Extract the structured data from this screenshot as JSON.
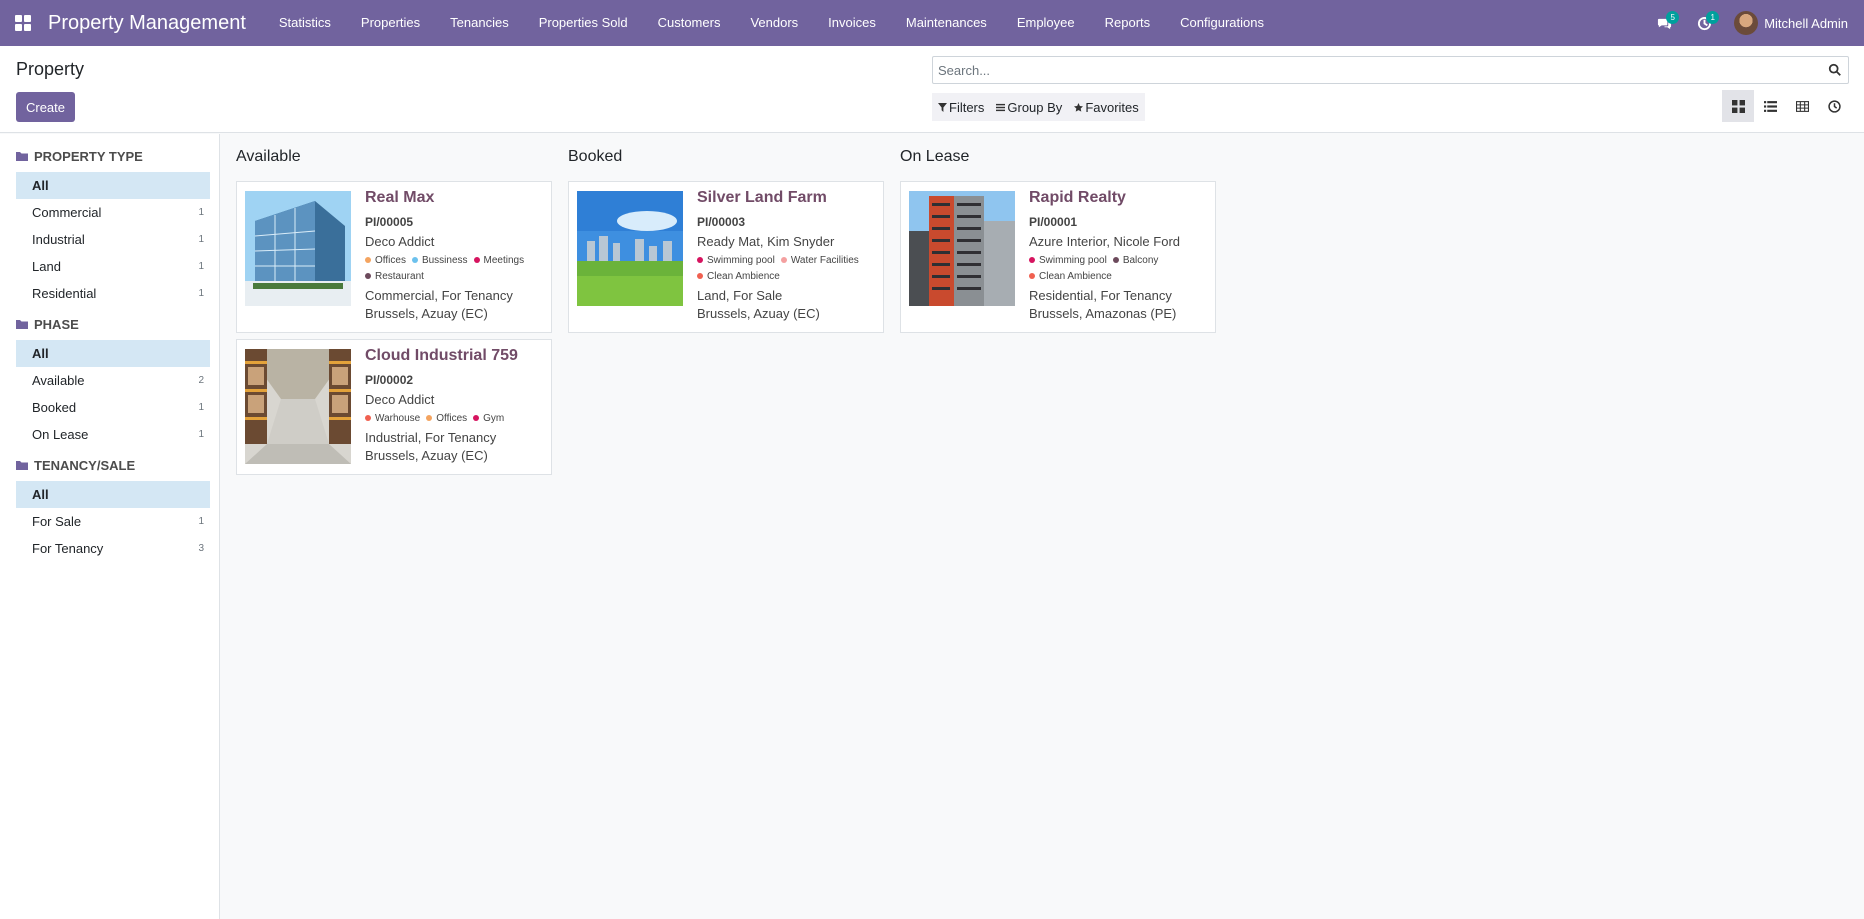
{
  "app": {
    "title": "Property Management"
  },
  "nav": {
    "items": [
      "Statistics",
      "Properties",
      "Tenancies",
      "Properties Sold",
      "Customers",
      "Vendors",
      "Invoices",
      "Maintenances",
      "Employee",
      "Reports",
      "Configurations"
    ],
    "messages_count": "5",
    "activities_count": "1",
    "user_name": "Mitchell Admin"
  },
  "control": {
    "breadcrumb": "Property",
    "create_label": "Create",
    "search_placeholder": "Search...",
    "filters_label": "Filters",
    "groupby_label": "Group By",
    "favorites_label": "Favorites"
  },
  "sidebar": {
    "sections": [
      {
        "title": "PROPERTY TYPE",
        "items": [
          {
            "label": "All",
            "count": "",
            "active": true
          },
          {
            "label": "Commercial",
            "count": "1"
          },
          {
            "label": "Industrial",
            "count": "1"
          },
          {
            "label": "Land",
            "count": "1"
          },
          {
            "label": "Residential",
            "count": "1"
          }
        ]
      },
      {
        "title": "PHASE",
        "items": [
          {
            "label": "All",
            "count": "",
            "active": true
          },
          {
            "label": "Available",
            "count": "2"
          },
          {
            "label": "Booked",
            "count": "1"
          },
          {
            "label": "On Lease",
            "count": "1"
          }
        ]
      },
      {
        "title": "TENANCY/SALE",
        "items": [
          {
            "label": "All",
            "count": "",
            "active": true
          },
          {
            "label": "For Sale",
            "count": "1"
          },
          {
            "label": "For Tenancy",
            "count": "3"
          }
        ]
      }
    ]
  },
  "kanban": {
    "columns": [
      {
        "title": "Available",
        "cards": [
          {
            "name": "Real Max",
            "ref": "PI/00005",
            "owner": "Deco Addict",
            "tags": [
              {
                "label": "Offices",
                "color": "#f4a460"
              },
              {
                "label": "Bussiness",
                "color": "#6cc1ed"
              },
              {
                "label": "Meetings",
                "color": "#d6145f"
              },
              {
                "label": "Restaurant",
                "color": "#6c4a5c"
              }
            ],
            "type_line": "Commercial, For Tenancy",
            "location": "Brussels, Azuay (EC)",
            "image": "building-glass"
          },
          {
            "name": "Cloud Industrial 759",
            "ref": "PI/00002",
            "owner": "Deco Addict",
            "tags": [
              {
                "label": "Warhouse",
                "color": "#f06050"
              },
              {
                "label": "Offices",
                "color": "#f4a460"
              },
              {
                "label": "Gym",
                "color": "#d6145f"
              }
            ],
            "type_line": "Industrial, For Tenancy",
            "location": "Brussels, Azuay (EC)",
            "image": "warehouse"
          }
        ]
      },
      {
        "title": "Booked",
        "cards": [
          {
            "name": "Silver Land Farm",
            "ref": "PI/00003",
            "owner": "Ready Mat, Kim Snyder",
            "tags": [
              {
                "label": "Swimming pool",
                "color": "#d6145f"
              },
              {
                "label": "Water Facilities",
                "color": "#f4a0a0"
              },
              {
                "label": "Clean Ambience",
                "color": "#f06050"
              }
            ],
            "type_line": "Land, For Sale",
            "location": "Brussels, Azuay (EC)",
            "image": "land-city"
          }
        ]
      },
      {
        "title": "On Lease",
        "cards": [
          {
            "name": "Rapid Realty",
            "ref": "PI/00001",
            "owner": "Azure Interior, Nicole Ford",
            "tags": [
              {
                "label": "Swimming pool",
                "color": "#d6145f"
              },
              {
                "label": "Balcony",
                "color": "#6c4a5c"
              },
              {
                "label": "Clean Ambience",
                "color": "#f06050"
              }
            ],
            "type_line": "Residential, For Tenancy",
            "location": "Brussels, Amazonas (PE)",
            "image": "tower"
          }
        ]
      }
    ]
  }
}
